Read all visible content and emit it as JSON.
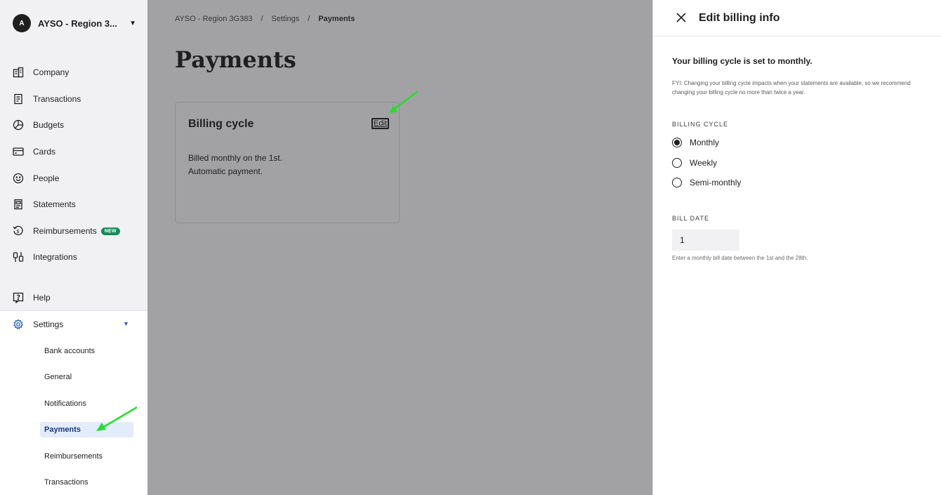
{
  "org": {
    "avatar_letter": "A",
    "name": "AYSO - Region 3..."
  },
  "sidebar": {
    "items": [
      {
        "label": "Company",
        "icon": "building-icon"
      },
      {
        "label": "Transactions",
        "icon": "receipt-icon"
      },
      {
        "label": "Budgets",
        "icon": "pie-chart-icon"
      },
      {
        "label": "Cards",
        "icon": "card-icon"
      },
      {
        "label": "People",
        "icon": "smiley-icon"
      },
      {
        "label": "Statements",
        "icon": "statement-icon"
      },
      {
        "label": "Reimbursements",
        "icon": "reimburse-icon",
        "badge": "NEW"
      },
      {
        "label": "Integrations",
        "icon": "plug-icon"
      }
    ],
    "help_label": "Help",
    "settings_label": "Settings",
    "settings_sub": [
      {
        "label": "Bank accounts"
      },
      {
        "label": "General"
      },
      {
        "label": "Notifications"
      },
      {
        "label": "Payments",
        "active": true
      },
      {
        "label": "Reimbursements"
      },
      {
        "label": "Transactions"
      }
    ]
  },
  "breadcrumb": {
    "org": "AYSO - Region 3G383",
    "sep": "/",
    "section": "Settings",
    "current": "Payments"
  },
  "page": {
    "title": "Payments"
  },
  "card": {
    "title": "Billing cycle",
    "edit_label": "Edit",
    "line1": "Billed monthly on the 1st.",
    "line2": "Automatic payment."
  },
  "panel": {
    "title": "Edit billing info",
    "heading": "Your billing cycle is set to monthly.",
    "fyi": "FYI: Changing your billing cycle impacts when your statements are available, so we recommend changing your billing cycle no more than twice a year.",
    "billing_cycle_label": "BILLING CYCLE",
    "options": [
      "Monthly",
      "Weekly",
      "Semi-monthly"
    ],
    "selected_option": "Monthly",
    "bill_date_label": "BILL DATE",
    "bill_date_value": "1",
    "bill_date_hint": "Enter a monthly bill date between the 1st and the 28th."
  },
  "colors": {
    "accent": "#2563c4",
    "overlay": "#a2a2a4",
    "badge_green": "#178a5c",
    "annotation_arrow": "#22e02a"
  }
}
